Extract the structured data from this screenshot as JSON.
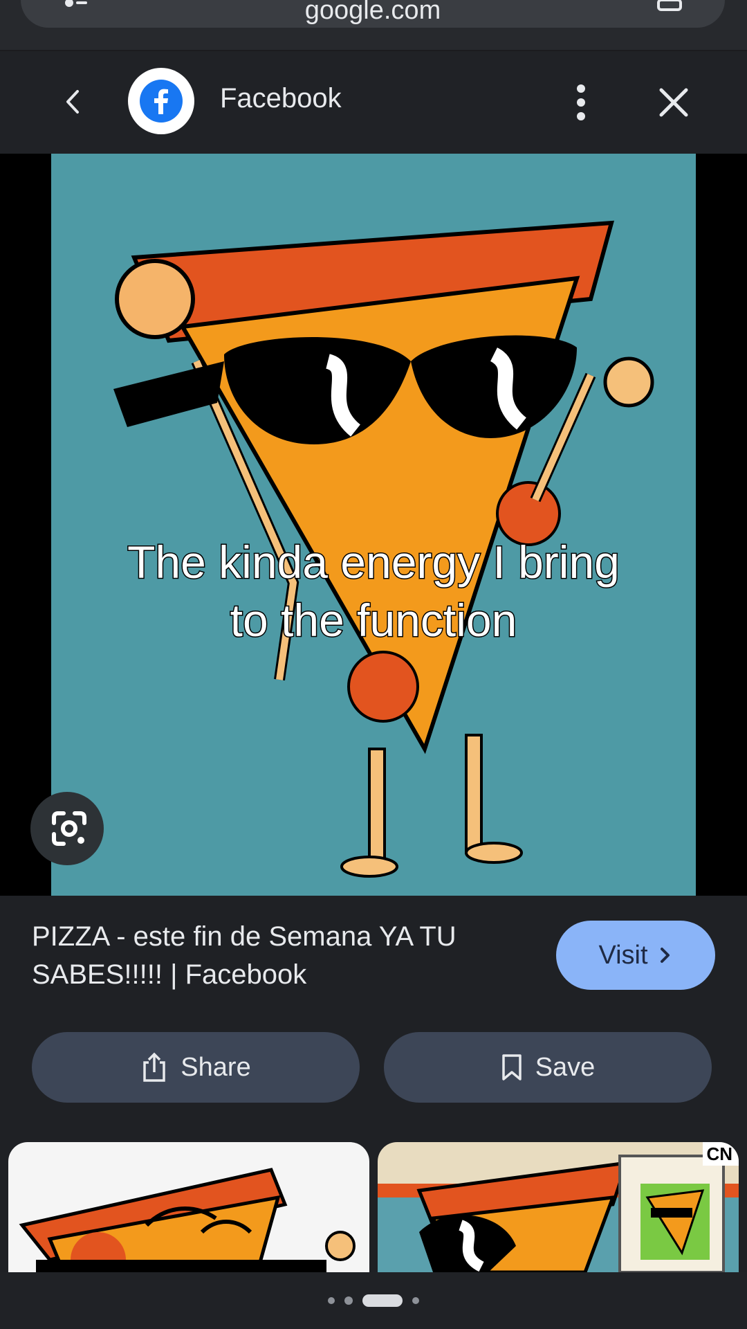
{
  "browser": {
    "url": "google.com"
  },
  "header": {
    "back_icon": "chevron-left-icon",
    "site_name": "Facebook",
    "logo": "facebook-logo-icon",
    "more_icon": "more-vert-icon",
    "close_icon": "close-icon"
  },
  "image": {
    "caption_line1": "The kinda energy I bring",
    "caption_line2": "to the function",
    "lens_icon": "google-lens-icon",
    "background_color": "#4e9aa5"
  },
  "result": {
    "title": "PIZZA - este fin de Semana YA TU SABES!!!!! | Facebook",
    "visit_label": "Visit",
    "share_label": "Share",
    "save_label": "Save"
  },
  "related": {
    "thumb2_badge": "CN"
  },
  "pager": {
    "active_index": 2,
    "count": 4
  },
  "colors": {
    "accent": "#8ab4f8",
    "pill_bg": "#3d4657",
    "page_bg": "#1f2125"
  }
}
